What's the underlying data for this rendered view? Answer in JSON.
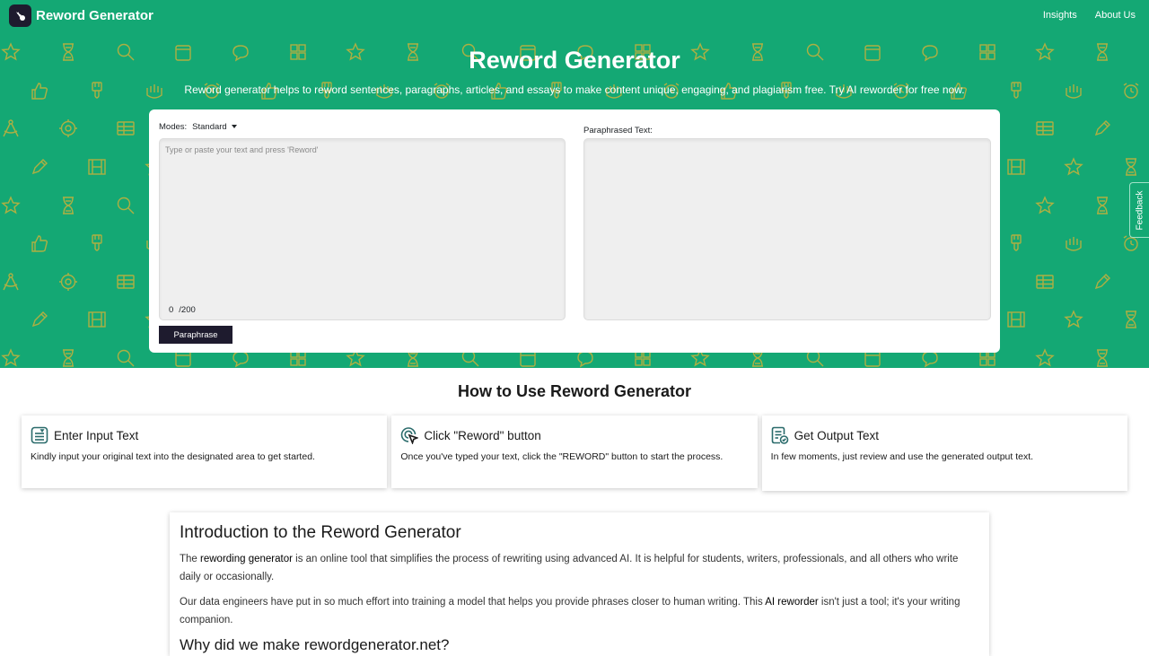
{
  "navbar": {
    "brand": "Reword Generator",
    "links": [
      {
        "label": "Insights"
      },
      {
        "label": "About Us"
      }
    ]
  },
  "hero": {
    "title": "Reword Generator",
    "subtitle": "Reword generator helps to reword sentences, paragraphs, articles, and essays to make content unique, engaging, and plagiarism free. Try AI reworder for free now."
  },
  "tool": {
    "modes_label": "Modes:",
    "mode_selected": "Standard",
    "input_placeholder": "Type or paste your text and press 'Reword'",
    "input_value": "",
    "char_count": "0",
    "char_limit": "/200",
    "paraphrase_button": "Paraphrase",
    "output_label": "Paraphrased Text:",
    "output_value": ""
  },
  "feedback": {
    "label": "Feedback"
  },
  "howto": {
    "title": "How to Use Reword Generator",
    "steps": [
      {
        "icon": "input-text-icon",
        "title": "Enter Input Text",
        "desc": "Kindly input your original text into the designated area to get started."
      },
      {
        "icon": "click-cursor-icon",
        "title": "Click \"Reword\" button",
        "desc": "Once you've typed your text, click the \"REWORD\" button to start the process."
      },
      {
        "icon": "output-document-icon",
        "title": "Get Output Text",
        "desc": "In few moments, just review and use the generated output text."
      }
    ]
  },
  "intro": {
    "title": "Introduction to the Reword Generator",
    "p1_pre": "The ",
    "p1_bold": "rewording generator",
    "p1_post": " is an online tool that simplifies the process of rewriting using advanced AI. It is helpful for students, writers, professionals, and all others who write daily or occasionally.",
    "p2_pre": "Our data engineers have put in so much effort into training a model that helps you provide phrases closer to human writing. This ",
    "p2_bold": "AI reworder",
    "p2_post": " isn't just a tool; it's your writing companion.",
    "subheading": "Why did we make rewordgenerator.net?"
  },
  "colors": {
    "brand_green": "#14a874",
    "pattern_icon": "#c9b13a",
    "dark_button": "#1e1b2e",
    "icon_teal": "#2a6b6b"
  }
}
